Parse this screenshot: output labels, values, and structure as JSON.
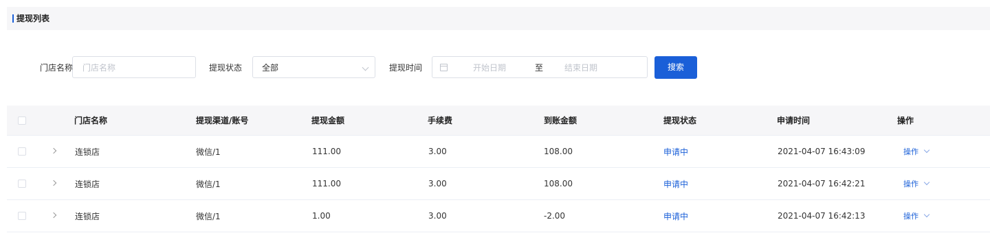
{
  "header": {
    "title": "提现列表"
  },
  "filters": {
    "store_label": "门店名称",
    "store_placeholder": "门店名称",
    "status_label": "提现状态",
    "status_value": "全部",
    "time_label": "提现时间",
    "start_placeholder": "开始日期",
    "separator": "至",
    "end_placeholder": "结束日期",
    "search_button": "搜索"
  },
  "table": {
    "columns": [
      "门店名称",
      "提现渠道/账号",
      "提现金额",
      "手续费",
      "到账金额",
      "提现状态",
      "申请时间",
      "操作"
    ],
    "rows": [
      {
        "store": "连锁店",
        "channel": "微信/1",
        "amount": "111.00",
        "fee": "3.00",
        "received": "108.00",
        "status": "申请中",
        "time": "2021-04-07 16:43:09",
        "action": "操作"
      },
      {
        "store": "连锁店",
        "channel": "微信/1",
        "amount": "111.00",
        "fee": "3.00",
        "received": "108.00",
        "status": "申请中",
        "time": "2021-04-07 16:42:21",
        "action": "操作"
      },
      {
        "store": "连锁店",
        "channel": "微信/1",
        "amount": "1.00",
        "fee": "3.00",
        "received": "-2.00",
        "status": "申请中",
        "time": "2021-04-07 16:42:13",
        "action": "操作"
      }
    ]
  },
  "colors": {
    "accent": "#1a5fd8",
    "header_bg": "#f6f6f8",
    "border": "#dcdfe6"
  },
  "icons": {
    "calendar": "calendar-icon",
    "chevron": "chevron-down-icon",
    "expand": "chevron-right-icon"
  }
}
